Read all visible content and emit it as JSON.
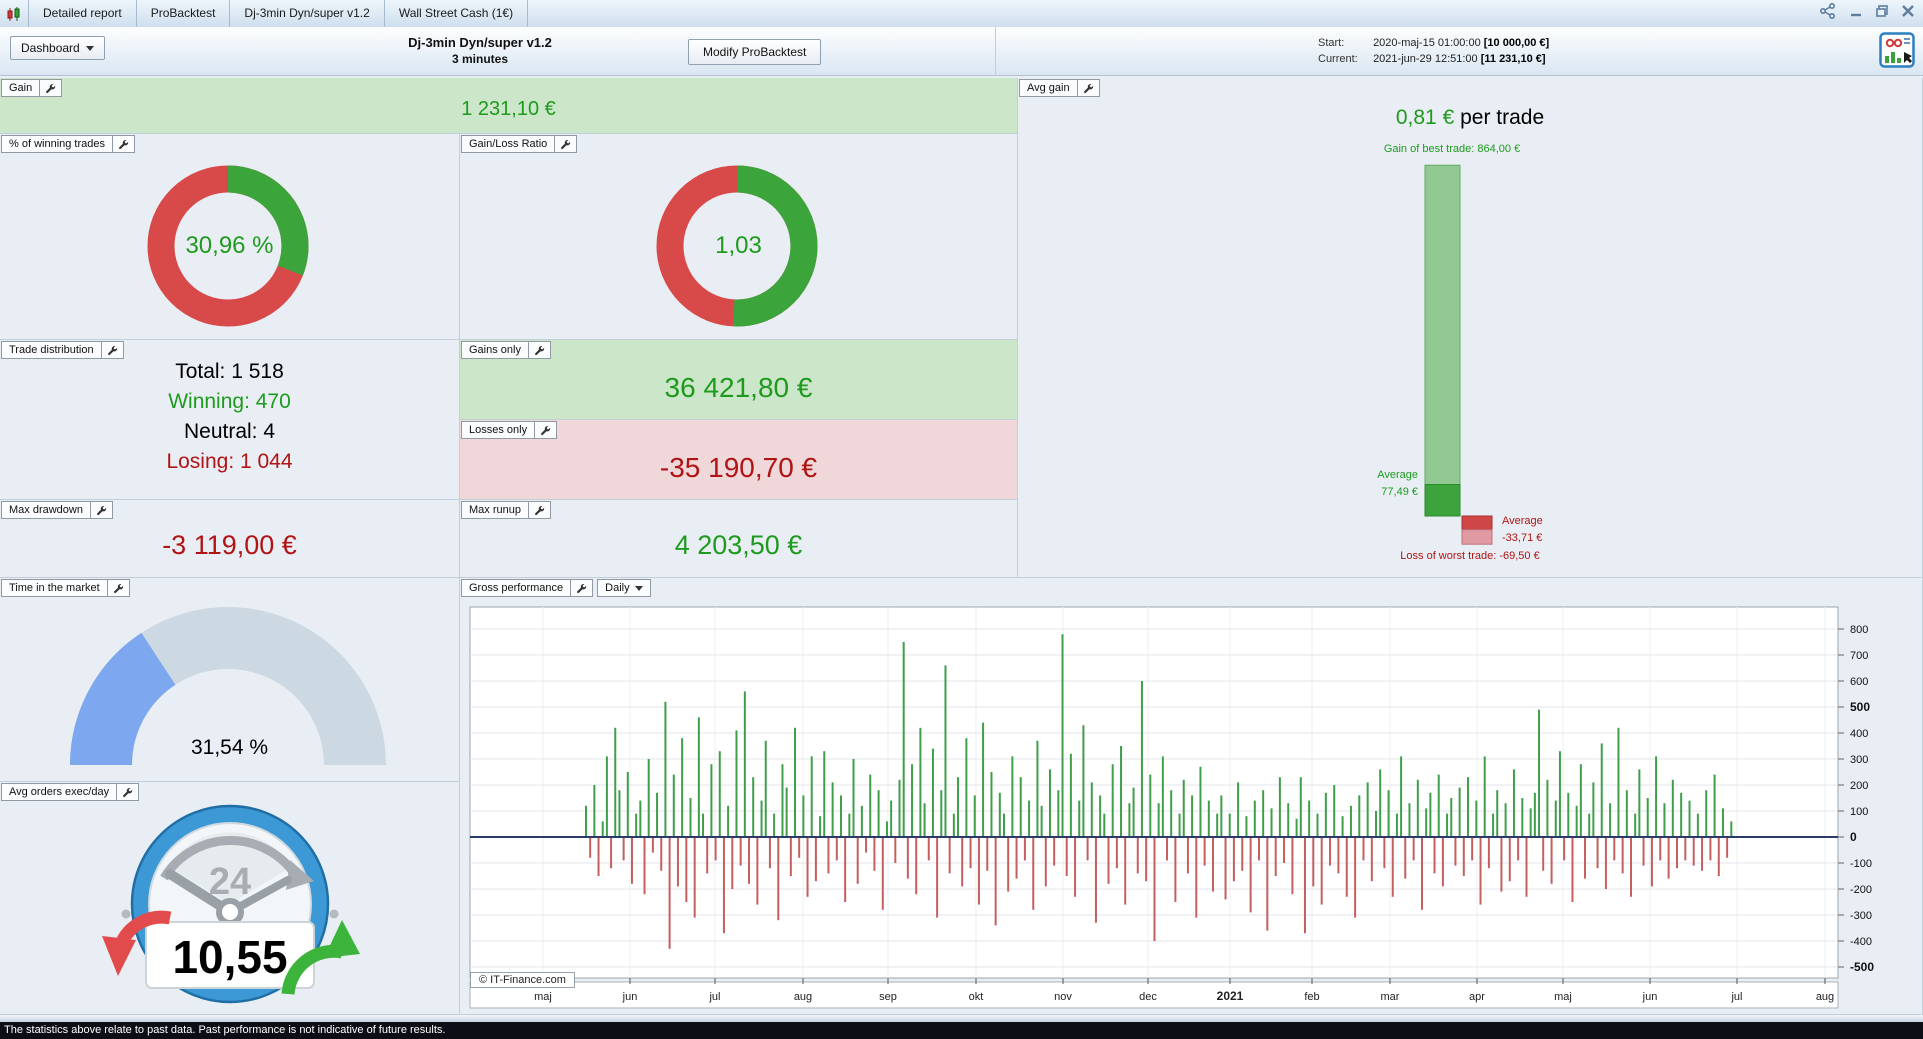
{
  "window": {
    "tabs": [
      "Detailed report",
      "ProBacktest",
      "Dj-3min Dyn/super v1.2",
      "Wall Street Cash (1€)"
    ]
  },
  "header": {
    "dashboard_label": "Dashboard",
    "title": "Dj-3min Dyn/super v1.2",
    "subtitle": "3 minutes",
    "modify_button": "Modify ProBacktest",
    "start_label": "Start:",
    "start_value": "2020-maj-15 01:00:00",
    "start_amount": "[10 000,00 €]",
    "current_label": "Current:",
    "current_value": "2021-jun-29 12:51:00",
    "current_amount": "[11 231,10 €]"
  },
  "panels": {
    "gain": {
      "label": "Gain",
      "value": "1 231,10 €"
    },
    "winning": {
      "label": "% of winning trades",
      "value": "30,96 %",
      "pct": 30.96
    },
    "ratio": {
      "label": "Gain/Loss Ratio",
      "value": "1,03",
      "ratio": 1.03
    },
    "trade_distribution": {
      "label": "Trade distribution",
      "rows": [
        {
          "text": "Total: 1 518"
        },
        {
          "text": "Winning: 470"
        },
        {
          "text": "Neutral: 4"
        },
        {
          "text": "Losing: 1 044"
        }
      ]
    },
    "gains_only": {
      "label": "Gains only",
      "value": "36 421,80 €"
    },
    "losses_only": {
      "label": "Losses only",
      "value": "-35 190,70 €"
    },
    "max_drawdown": {
      "label": "Max drawdown",
      "value": "-3 119,00 €"
    },
    "max_runup": {
      "label": "Max runup",
      "value": "4 203,50 €"
    },
    "time_in_market": {
      "label": "Time in the market",
      "value": "31,54 %",
      "pct": 31.54
    },
    "avg_orders": {
      "label": "Avg orders exec/day",
      "value": "10,55",
      "clock_text": "24"
    },
    "avg_gain": {
      "label": "Avg gain",
      "value": "0,81 €",
      "suffix": " per trade",
      "best_label": "Gain of best trade: 864,00 €",
      "avg_gain_label": "Average",
      "avg_gain_value": "77,49 €",
      "avg_loss_label": "Average",
      "avg_loss_value": "-33,71 €",
      "worst_label": "Loss of worst trade: -69,50 €",
      "best_num": 864.0,
      "avg_gain_num": 77.49,
      "avg_loss_num": -33.71,
      "worst_num": -69.5
    },
    "gross_performance": {
      "label": "Gross performance",
      "period": "Daily",
      "copyright": "© IT-Finance.com"
    }
  },
  "chart_data": {
    "type": "bar",
    "title": "Gross performance (Daily)",
    "x_labels": [
      "maj",
      "jun",
      "jul",
      "aug",
      "sep",
      "okt",
      "nov",
      "dec",
      "2021",
      "feb",
      "mar",
      "apr",
      "maj",
      "jun",
      "jul",
      "aug"
    ],
    "ylim": [
      -500,
      800
    ],
    "ytick_step": 100,
    "bold_ticks": [
      500,
      0,
      -500
    ],
    "values": [
      120,
      -80,
      200,
      -150,
      60,
      310,
      -120,
      420,
      180,
      -90,
      250,
      -180,
      90,
      140,
      -220,
      300,
      -60,
      170,
      -130,
      520,
      -430,
      240,
      -190,
      380,
      -250,
      150,
      -310,
      460,
      90,
      -140,
      280,
      -90,
      330,
      -370,
      120,
      -200,
      410,
      -110,
      560,
      -180,
      230,
      -260,
      140,
      370,
      -120,
      90,
      -320,
      280,
      190,
      -150,
      420,
      -80,
      160,
      -230,
      310,
      -170,
      80,
      330,
      -140,
      210,
      -90,
      160,
      -250,
      90,
      300,
      -180,
      120,
      -60,
      240,
      -130,
      180,
      -280,
      60,
      140,
      -100,
      220,
      750,
      -160,
      280,
      -220,
      420,
      130,
      -90,
      340,
      -310,
      180,
      660,
      -140,
      90,
      230,
      -190,
      380,
      -120,
      160,
      -260,
      440,
      -130,
      250,
      -340,
      170,
      90,
      -210,
      310,
      -160,
      230,
      -90,
      140,
      -280,
      370,
      120,
      -190,
      260,
      -110,
      180,
      780,
      -150,
      320,
      -230,
      140,
      430,
      -90,
      210,
      -330,
      160,
      90,
      -180,
      280,
      -120,
      350,
      -260,
      130,
      190,
      -140,
      600,
      -170,
      240,
      -400,
      130,
      310,
      -90,
      180,
      -250,
      90,
      220,
      -140,
      160,
      -310,
      270,
      -110,
      140,
      -210,
      90,
      160,
      -240,
      90,
      -170,
      210,
      -130,
      80,
      -290,
      140,
      -90,
      180,
      -360,
      110,
      -150,
      230,
      -100,
      130,
      -220,
      70,
      230,
      -370,
      140,
      -190,
      90,
      -260,
      170,
      -110,
      200,
      -140,
      80,
      -230,
      120,
      -310,
      160,
      -90,
      210,
      -170,
      100,
      260,
      -120,
      180,
      -230,
      90,
      310,
      -160,
      130,
      -90,
      220,
      -280,
      110,
      170,
      -140,
      240,
      -190,
      90,
      150,
      -110,
      190,
      -150,
      230,
      -90,
      140,
      -260,
      310,
      -120,
      90,
      180,
      -210,
      130,
      -170,
      260,
      -90,
      150,
      -230,
      110,
      170,
      490,
      -130,
      220,
      -180,
      140,
      330,
      -90,
      170,
      -250,
      120,
      280,
      -160,
      90,
      210,
      -120,
      360,
      -200,
      130,
      -90,
      420,
      -140,
      180,
      -230,
      90,
      260,
      -110,
      150,
      -190,
      310,
      -90,
      130,
      -160,
      220,
      -120,
      170,
      -90,
      140,
      -110,
      90,
      -130,
      180,
      -90,
      240,
      -150,
      110,
      -80,
      60
    ]
  },
  "colors": {
    "green_text": "#1e9a1e",
    "red_text": "#b01414",
    "donut_green": "#3ba43b",
    "donut_red": "#d84a4a",
    "gauge_blue": "#7da8f0",
    "bar_green": "#3f9e4a",
    "bar_red": "#c55f5f",
    "zero_line": "#2b3a66"
  },
  "footer": {
    "text": "The statistics above relate to past data. Past performance is not indicative of future results."
  }
}
